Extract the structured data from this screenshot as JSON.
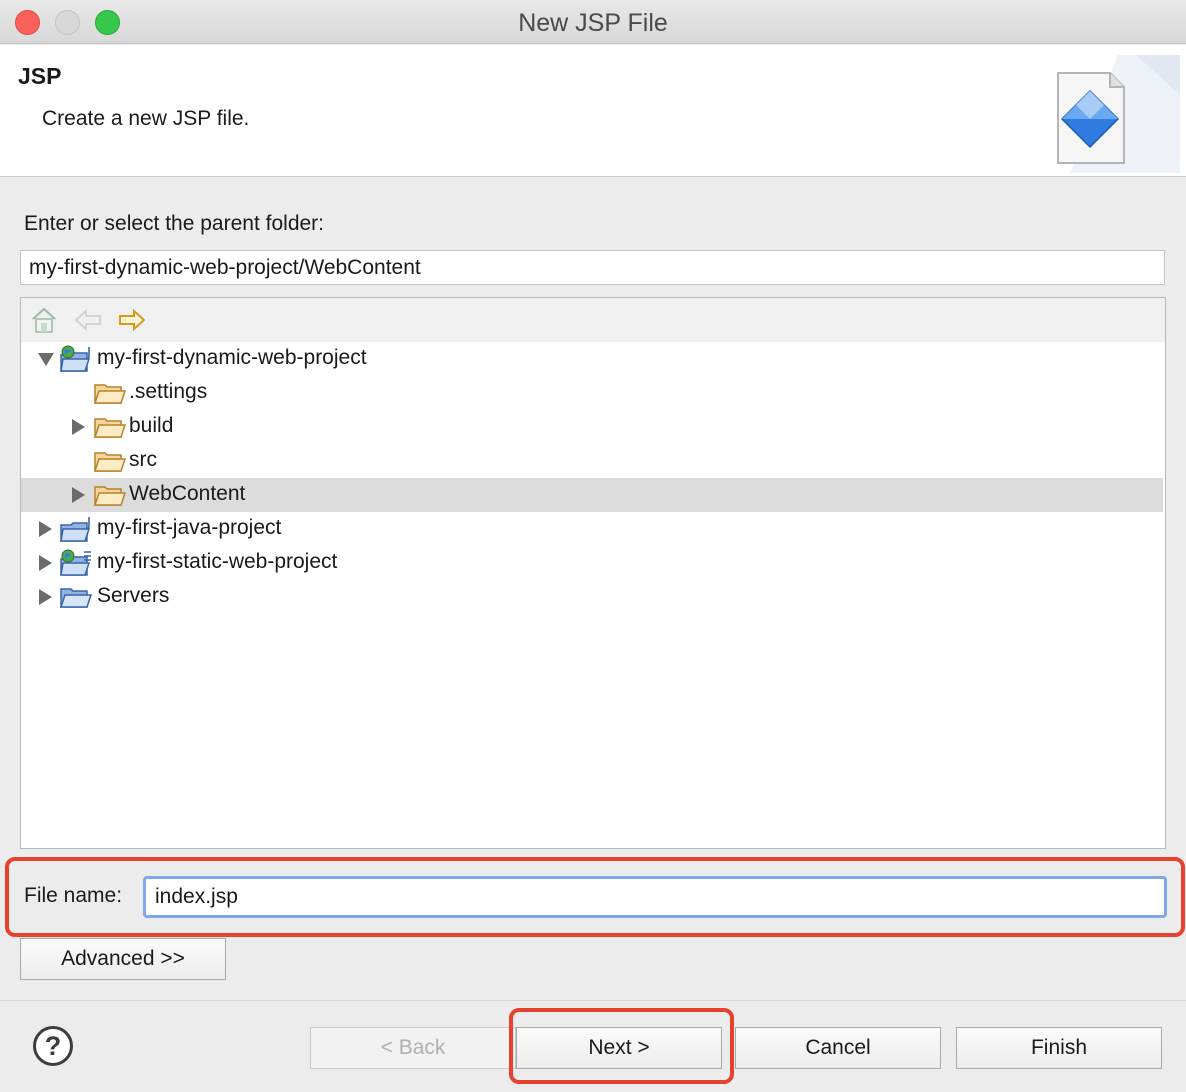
{
  "window": {
    "title": "New JSP File"
  },
  "header": {
    "title": "JSP",
    "description": "Create a new JSP file."
  },
  "folder": {
    "label": "Enter or select the parent folder:",
    "value": "my-first-dynamic-web-project/WebContent"
  },
  "toolbar": {
    "icons": [
      "home-icon",
      "back-arrow-icon",
      "forward-arrow-icon"
    ]
  },
  "tree": {
    "items": [
      {
        "label": "my-first-dynamic-web-project",
        "expanded": true,
        "icon": "web-project-icon"
      },
      {
        "label": ".settings",
        "icon": "folder-icon"
      },
      {
        "label": "build",
        "icon": "folder-icon"
      },
      {
        "label": "src",
        "icon": "folder-icon"
      },
      {
        "label": "WebContent",
        "icon": "folder-icon",
        "selected": true
      },
      {
        "label": "my-first-java-project",
        "icon": "java-project-icon"
      },
      {
        "label": "my-first-static-web-project",
        "icon": "web-project-icon"
      },
      {
        "label": "Servers",
        "icon": "folder-icon"
      }
    ]
  },
  "file": {
    "label": "File name:",
    "value": "index.jsp"
  },
  "buttons": {
    "advanced": "Advanced >>",
    "back": "< Back",
    "next": "Next >",
    "cancel": "Cancel",
    "finish": "Finish",
    "help": "?"
  },
  "colors": {
    "highlight": "#e8412f",
    "focus": "#7fa8e8",
    "selected_row": "#dcdcdc"
  }
}
